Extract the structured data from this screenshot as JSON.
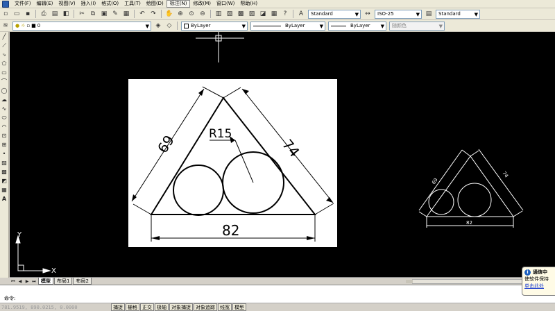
{
  "menubar": {
    "items": [
      "文件(F)",
      "编辑(E)",
      "视图(V)",
      "插入(I)",
      "格式(O)",
      "工具(T)",
      "绘图(D)",
      "标注(N)",
      "修改(M)",
      "窗口(W)",
      "帮助(H)"
    ],
    "active_item": "标注(N)"
  },
  "toolbar1": {
    "text_style": "Standard",
    "dim_style": "ISO-25",
    "table_style": "Standard"
  },
  "toolbar2": {
    "layer": "0",
    "color": "ByLayer",
    "linetype": "ByLayer",
    "lineweight": "ByLayer",
    "plot_style": "随颜色"
  },
  "drawing": {
    "main": {
      "dim_left": "69",
      "dim_right": "74",
      "dim_bottom": "82",
      "radius": "R15"
    },
    "small": {
      "dim_left": "69",
      "dim_right": "74",
      "dim_bottom": "82"
    },
    "ucs_x": "X",
    "ucs_y": "Y"
  },
  "layout_tabs": [
    "模型",
    "布局1",
    "布局2"
  ],
  "command": {
    "prompt": "命令:"
  },
  "status": {
    "coords": "781.9519, 890.0215, 0.0000",
    "buttons": [
      "捕捉",
      "栅格",
      "正交",
      "极轴",
      "对象捕捉",
      "对象追踪",
      "线宽",
      "模型"
    ]
  },
  "notification": {
    "title": "通信中",
    "line1": "使软件保持",
    "link": "单击此处"
  }
}
